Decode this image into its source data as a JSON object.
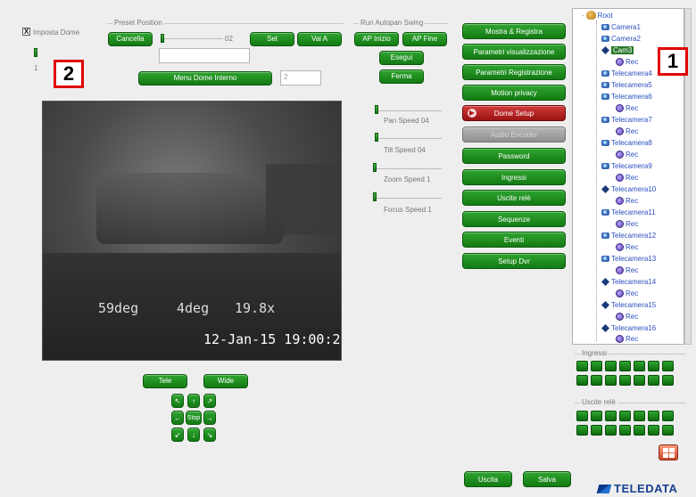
{
  "dome": {
    "checkbox_label": "Imposta Dome",
    "checked_mark": "X",
    "slider_value": "1"
  },
  "preset": {
    "title": "Preset Position",
    "cancel_label": "Cancella",
    "value": "02",
    "set_label": "Set",
    "goto_label": "Vai A",
    "name_value": ""
  },
  "autopan": {
    "title": "Run Autopan Swing",
    "start_label": "AP Inizio",
    "end_label": "AP Fine",
    "run_label": "Esegui",
    "stop_label": "Ferma"
  },
  "menu_dome": {
    "label": "Menu Dome Interno",
    "value": "2"
  },
  "video": {
    "pan_text": "59deg",
    "tilt_text": "4deg",
    "zoom_text": "19.8x",
    "datetime": "12-Jan-15 19:00:27"
  },
  "speeds": [
    {
      "label": "Pan Speed 04"
    },
    {
      "label": "Tilt Speed 04"
    },
    {
      "label": "Zoom Speed 1"
    },
    {
      "label": "Focus Speed 1"
    }
  ],
  "menu": [
    {
      "label": "Mostra & Registra",
      "state": "normal"
    },
    {
      "label": "Parametri visualizzazione",
      "state": "normal"
    },
    {
      "label": "Parametri Registrazione",
      "state": "normal"
    },
    {
      "label": "Motion privacy",
      "state": "normal"
    },
    {
      "label": "Dome Setup",
      "state": "active"
    },
    {
      "label": "Audio Encoder",
      "state": "disabled"
    },
    {
      "label": "Password",
      "state": "normal"
    },
    {
      "label": "Ingressi",
      "state": "normal"
    },
    {
      "label": "Uscite relè",
      "state": "normal"
    },
    {
      "label": "Sequenze",
      "state": "normal"
    },
    {
      "label": "Eventi",
      "state": "normal"
    },
    {
      "label": "Setup Dvr",
      "state": "normal"
    }
  ],
  "ptz": {
    "tele_label": "Tele",
    "wide_label": "Wide",
    "stop_label": "Stop"
  },
  "footer": {
    "exit_label": "Uscita",
    "save_label": "Salva"
  },
  "tree": {
    "root": "Root",
    "cameras": [
      "Camera1",
      "Camera2",
      "Cam3",
      "Telecamera4",
      "Telecamera5",
      "Telecamera6",
      "Telecamera7",
      "Telecamera8",
      "Telecamera9",
      "Telecamera10",
      "Telecamera11",
      "Telecamera12",
      "Telecamera13",
      "Telecamera14",
      "Telecamera15",
      "Telecamera16"
    ],
    "rec_label": "Rec"
  },
  "ingressi": {
    "title": "Ingressi"
  },
  "uscite": {
    "title": "Uscite relè"
  },
  "brand": {
    "logo": "TELEDATA"
  },
  "callouts": {
    "one": "1",
    "two": "2"
  },
  "colors": {
    "green": "#1f8f1f",
    "red": "#b01c1c",
    "accent_callout": "#e00000"
  }
}
